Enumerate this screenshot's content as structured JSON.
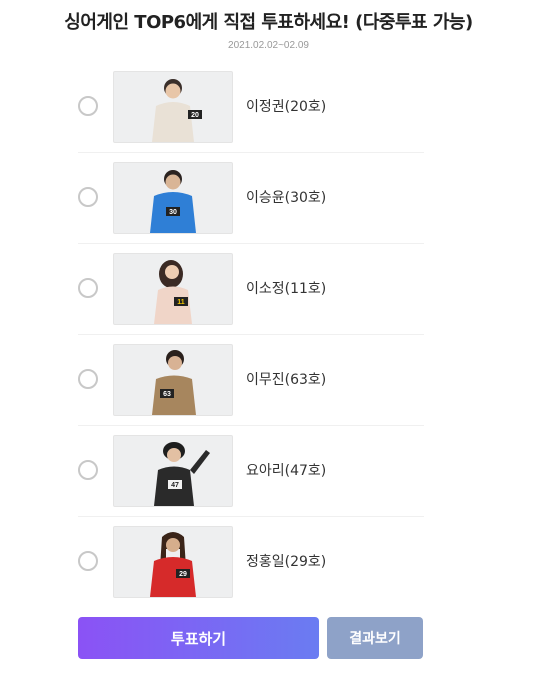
{
  "poll": {
    "title": "싱어게인 TOP6에게 직접 투표하세요! (다중투표 가능)",
    "date_range": "2021.02.02~02.09"
  },
  "candidates": [
    {
      "name": "이정권(20호)",
      "badge": "20",
      "outfit_color": "#e9e1d6"
    },
    {
      "name": "이승윤(30호)",
      "badge": "30",
      "outfit_color": "#2f7fd6"
    },
    {
      "name": "이소정(11호)",
      "badge": "11",
      "outfit_color": "#f0d5c8"
    },
    {
      "name": "이무진(63호)",
      "badge": "63",
      "outfit_color": "#a7865e"
    },
    {
      "name": "요아리(47호)",
      "badge": "47",
      "outfit_color": "#2a2a2a"
    },
    {
      "name": "정홍일(29호)",
      "badge": "29",
      "outfit_color": "#d62a2a"
    }
  ],
  "buttons": {
    "vote_label": "투표하기",
    "result_label": "결과보기"
  }
}
